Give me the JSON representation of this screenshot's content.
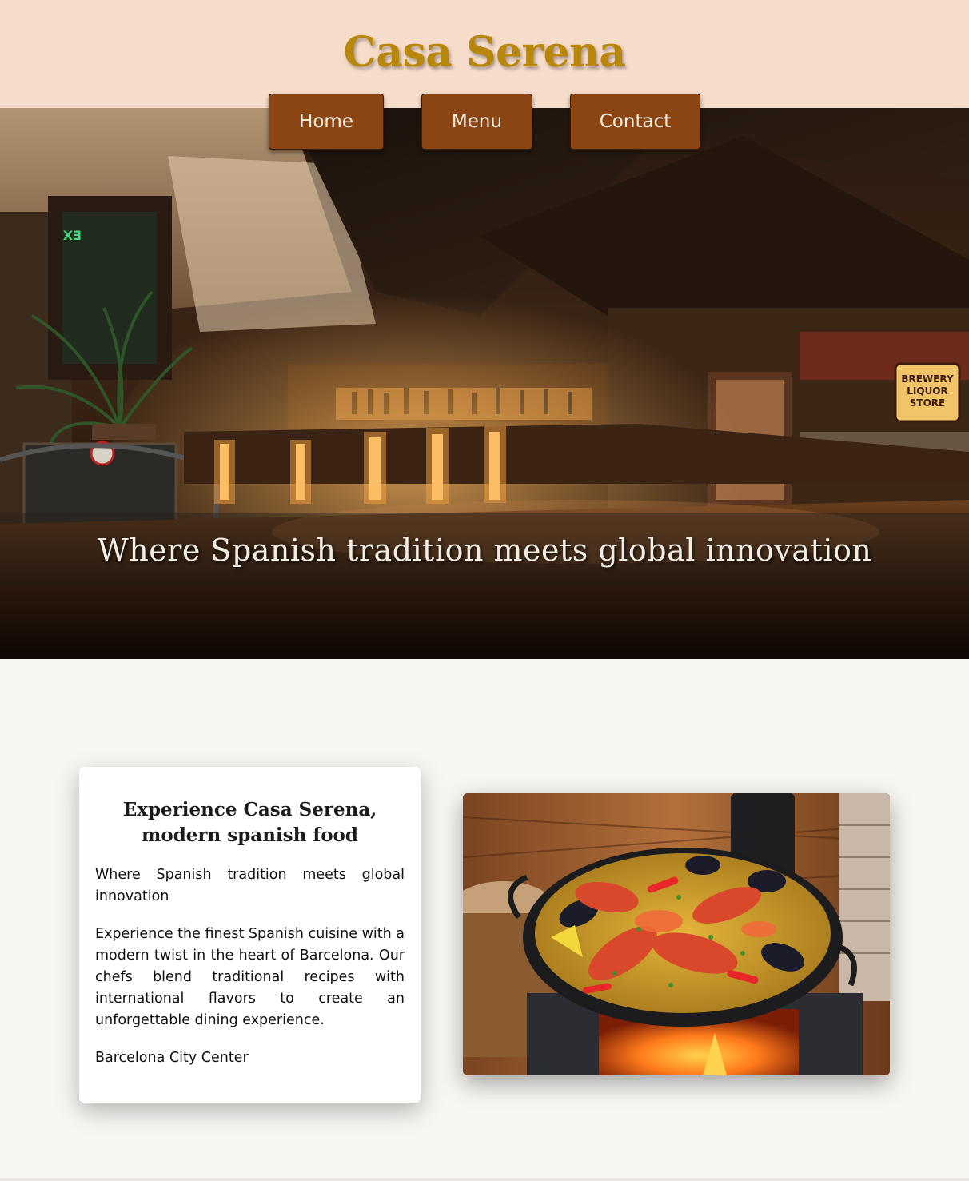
{
  "site": {
    "brand": "Casa Serena",
    "colors": {
      "header_bg": "#f6dccb",
      "brand": "#b8860b",
      "nav_bg": "#8b4513",
      "page_bg": "#f8f6f2"
    }
  },
  "nav": {
    "items": [
      {
        "label": "Home"
      },
      {
        "label": "Menu"
      },
      {
        "label": "Contact"
      }
    ]
  },
  "hero": {
    "tagline": "Where Spanish tradition meets global innovation",
    "image": "restaurant-bar-interior-photo",
    "signs": {
      "exit": "EX",
      "store_line1": "BREWERY",
      "store_line2": "LIQUOR",
      "store_line3": "STORE"
    }
  },
  "about": {
    "title": "Experience Casa Serena, modern spanish food",
    "subtitle": "Where Spanish tradition meets global innovation",
    "description": "Experience the finest Spanish cuisine with a modern twist in the heart of Barcelona. Our chefs blend traditional recipes with international flavors to create an unforgettable dining experience.",
    "location": "Barcelona City Center",
    "image": "seafood-paella-photo"
  }
}
